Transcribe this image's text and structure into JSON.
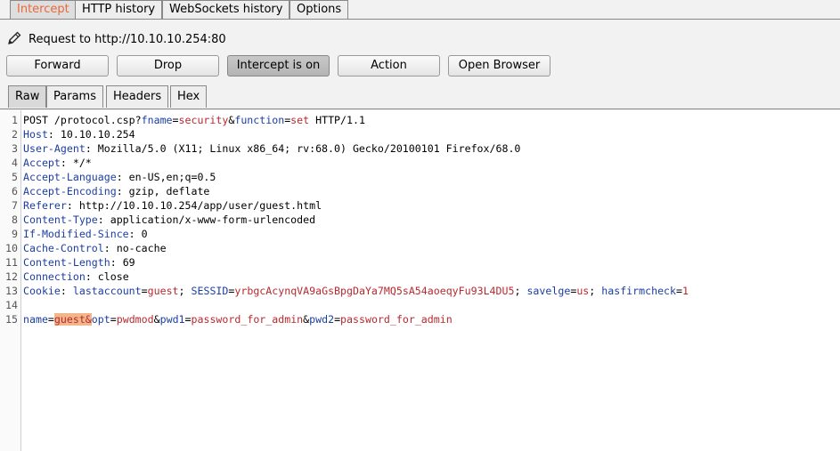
{
  "tabs": [
    {
      "label": "Intercept",
      "active": true
    },
    {
      "label": "HTTP history",
      "active": false
    },
    {
      "label": "WebSockets history",
      "active": false
    },
    {
      "label": "Options",
      "active": false
    }
  ],
  "request": {
    "title": "Request to http://10.10.10.254:80",
    "icon": "pencil-icon"
  },
  "buttons": {
    "forward": "Forward",
    "drop": "Drop",
    "intercept": "Intercept is on",
    "action": "Action",
    "open_browser": "Open Browser"
  },
  "subtabs": [
    {
      "label": "Raw",
      "active": true
    },
    {
      "label": "Params",
      "active": false
    },
    {
      "label": "Headers",
      "active": false
    },
    {
      "label": "Hex",
      "active": false
    }
  ],
  "colors": {
    "accent": "#e8683a",
    "key": "#1b3ea5",
    "value": "#b8292f",
    "highlight": "#f3b58a"
  },
  "editor": {
    "lines": [
      {
        "num": "1",
        "segments": [
          {
            "t": "POST /protocol.csp?",
            "c": ""
          },
          {
            "t": "fname",
            "c": "k"
          },
          {
            "t": "=",
            "c": ""
          },
          {
            "t": "security",
            "c": "v"
          },
          {
            "t": "&",
            "c": ""
          },
          {
            "t": "function",
            "c": "k"
          },
          {
            "t": "=",
            "c": ""
          },
          {
            "t": "set",
            "c": "v"
          },
          {
            "t": " HTTP/1.1",
            "c": ""
          }
        ]
      },
      {
        "num": "2",
        "segments": [
          {
            "t": "Host",
            "c": "k"
          },
          {
            "t": ": 10.10.10.254",
            "c": ""
          }
        ]
      },
      {
        "num": "3",
        "segments": [
          {
            "t": "User-Agent",
            "c": "k"
          },
          {
            "t": ": Mozilla/5.0 (X11; Linux x86_64; rv:68.0) Gecko/20100101 Firefox/68.0",
            "c": ""
          }
        ]
      },
      {
        "num": "4",
        "segments": [
          {
            "t": "Accept",
            "c": "k"
          },
          {
            "t": ": */*",
            "c": ""
          }
        ]
      },
      {
        "num": "5",
        "segments": [
          {
            "t": "Accept-Language",
            "c": "k"
          },
          {
            "t": ": en-US,en;q=0.5",
            "c": ""
          }
        ]
      },
      {
        "num": "6",
        "segments": [
          {
            "t": "Accept-Encoding",
            "c": "k"
          },
          {
            "t": ": gzip, deflate",
            "c": ""
          }
        ]
      },
      {
        "num": "7",
        "segments": [
          {
            "t": "Referer",
            "c": "k"
          },
          {
            "t": ": http://10.10.10.254/app/user/guest.html",
            "c": ""
          }
        ]
      },
      {
        "num": "8",
        "segments": [
          {
            "t": "Content-Type",
            "c": "k"
          },
          {
            "t": ": application/x-www-form-urlencoded",
            "c": ""
          }
        ]
      },
      {
        "num": "9",
        "segments": [
          {
            "t": "If-Modified-Since",
            "c": "k"
          },
          {
            "t": ": 0",
            "c": ""
          }
        ]
      },
      {
        "num": "10",
        "segments": [
          {
            "t": "Cache-Control",
            "c": "k"
          },
          {
            "t": ": no-cache",
            "c": ""
          }
        ]
      },
      {
        "num": "11",
        "segments": [
          {
            "t": "Content-Length",
            "c": "k"
          },
          {
            "t": ": 69",
            "c": ""
          }
        ]
      },
      {
        "num": "12",
        "segments": [
          {
            "t": "Connection",
            "c": "k"
          },
          {
            "t": ": close",
            "c": ""
          }
        ]
      },
      {
        "num": "13",
        "segments": [
          {
            "t": "Cookie",
            "c": "k"
          },
          {
            "t": ": ",
            "c": ""
          },
          {
            "t": "lastaccount",
            "c": "k"
          },
          {
            "t": "=",
            "c": ""
          },
          {
            "t": "guest",
            "c": "v"
          },
          {
            "t": "; ",
            "c": ""
          },
          {
            "t": "SESSID",
            "c": "k"
          },
          {
            "t": "=",
            "c": ""
          },
          {
            "t": "yrbgcAcynqVA9aGsBpgDaYa7MQ5sA54aoeqyFu93L4DU5",
            "c": "v"
          },
          {
            "t": "; ",
            "c": ""
          },
          {
            "t": "savelge",
            "c": "k"
          },
          {
            "t": "=",
            "c": ""
          },
          {
            "t": "us",
            "c": "v"
          },
          {
            "t": "; ",
            "c": ""
          },
          {
            "t": "hasfirmcheck",
            "c": "k"
          },
          {
            "t": "=",
            "c": ""
          },
          {
            "t": "1",
            "c": "v"
          }
        ]
      },
      {
        "num": "14",
        "segments": []
      },
      {
        "num": "15",
        "segments": [
          {
            "t": "name",
            "c": "k"
          },
          {
            "t": "=",
            "c": ""
          },
          {
            "t": "guest&",
            "c": "v hl caret"
          },
          {
            "t": "opt",
            "c": "k"
          },
          {
            "t": "=",
            "c": ""
          },
          {
            "t": "pwdmod",
            "c": "v"
          },
          {
            "t": "&",
            "c": ""
          },
          {
            "t": "pwd1",
            "c": "k"
          },
          {
            "t": "=",
            "c": ""
          },
          {
            "t": "password_for_admin",
            "c": "v"
          },
          {
            "t": "&",
            "c": ""
          },
          {
            "t": "pwd2",
            "c": "k"
          },
          {
            "t": "=",
            "c": ""
          },
          {
            "t": "password_for_admin",
            "c": "v"
          }
        ]
      }
    ]
  }
}
